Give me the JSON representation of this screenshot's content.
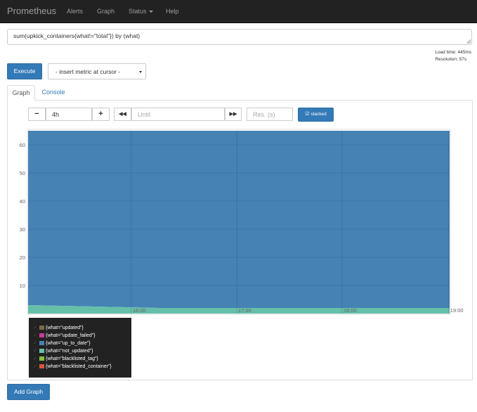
{
  "navbar": {
    "brand": "Prometheus",
    "items": [
      {
        "label": "Alerts"
      },
      {
        "label": "Graph"
      },
      {
        "label": "Status"
      },
      {
        "label": "Help"
      }
    ]
  },
  "expression": {
    "value": "sum(upkick_containers{what!=\"total\"}) by (what)"
  },
  "stats": {
    "load_time": "Load time: 445ms",
    "resolution": "Resolution: 57s"
  },
  "execute_label": "Execute",
  "metric_select": {
    "selected": "- insert metric at cursor -"
  },
  "tabs": [
    {
      "label": "Graph",
      "active": true
    },
    {
      "label": "Console",
      "active": false
    }
  ],
  "graph_controls": {
    "minus": "−",
    "range_value": "4h",
    "plus": "+",
    "back": "◀◀",
    "until_placeholder": "Until",
    "forward": "▶▶",
    "res_placeholder": "Res. (s)",
    "stacked_label": "stacked"
  },
  "chart_data": {
    "type": "area",
    "stacked": true,
    "x_ticks": [
      "16:00",
      "17:00",
      "18:00",
      "19:00"
    ],
    "y_ticks": [
      10,
      20,
      30,
      40,
      50,
      60
    ],
    "ylim": [
      0,
      65
    ],
    "xlim": [
      "15:01",
      "19:01"
    ],
    "series": [
      {
        "name": "{what=\"updated\"}",
        "color": "#7a6a44",
        "values": [
          [
            0,
            0
          ],
          [
            1,
            0
          ]
        ]
      },
      {
        "name": "{what=\"update_failed\"}",
        "color": "#c73a9b",
        "values": [
          [
            0,
            0
          ],
          [
            1,
            0
          ]
        ]
      },
      {
        "name": "{what=\"up_to_date\"}",
        "color": "#4682b4",
        "values": [
          [
            0,
            62
          ],
          [
            0.31,
            62
          ],
          [
            0.31,
            63
          ],
          [
            1,
            63
          ]
        ]
      },
      {
        "name": "{what=\"not_updated\"}",
        "color": "#66bfa8",
        "values": [
          [
            0,
            3
          ],
          [
            0.31,
            3
          ],
          [
            0.31,
            2
          ],
          [
            1,
            2
          ]
        ]
      },
      {
        "name": "{what=\"blacklisted_tag\"}",
        "color": "#86c239",
        "values": [
          [
            0,
            0
          ],
          [
            1,
            0
          ]
        ]
      },
      {
        "name": "{what=\"blacklisted_container\"}",
        "color": "#d9533b",
        "values": [
          [
            0,
            0
          ],
          [
            1,
            0
          ]
        ]
      }
    ]
  },
  "add_graph_label": "Add Graph"
}
